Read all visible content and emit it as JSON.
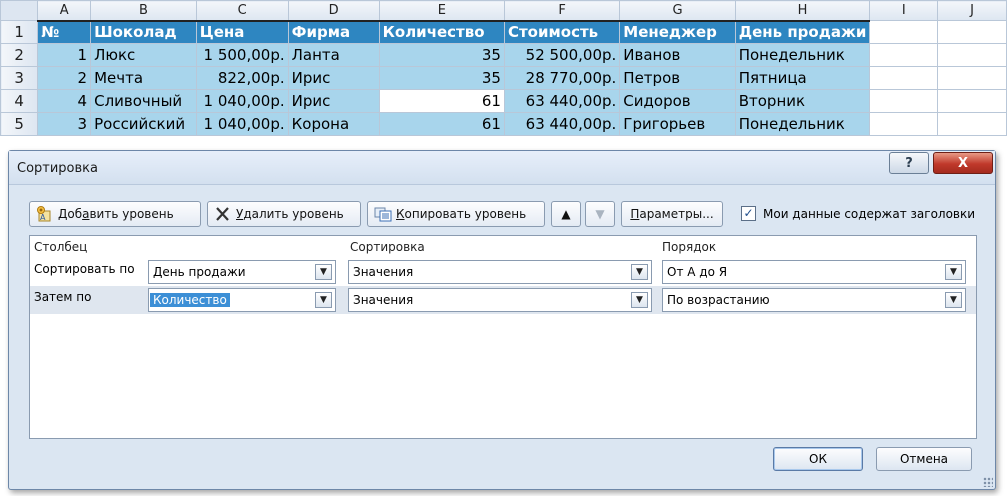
{
  "sheet": {
    "corner": "",
    "col_letters": [
      "A",
      "B",
      "C",
      "D",
      "E",
      "F",
      "G",
      "H",
      "I",
      "J"
    ],
    "rows": [
      {
        "n": "1",
        "cells": [
          "№",
          "Шоколад",
          "Цена",
          "Фирма",
          "Количество",
          "Стоимость",
          "Менеджер",
          "День продажи"
        ]
      },
      {
        "n": "2",
        "cells": [
          "1",
          "Люкс",
          "1 500,00р.",
          "Ланта",
          "35",
          "52 500,00р.",
          "Иванов",
          "Понедельник"
        ]
      },
      {
        "n": "3",
        "cells": [
          "2",
          "Мечта",
          "822,00р.",
          "Ирис",
          "35",
          "28 770,00р.",
          "Петров",
          "Пятница"
        ]
      },
      {
        "n": "4",
        "cells": [
          "4",
          "Сливочный",
          "1 040,00р.",
          "Ирис",
          "61",
          "63 440,00р.",
          "Сидоров",
          "Вторник"
        ]
      },
      {
        "n": "5",
        "cells": [
          "3",
          "Российский",
          "1 040,00р.",
          "Корона",
          "61",
          "63 440,00р.",
          "Григорьев",
          "Понедельник"
        ]
      }
    ]
  },
  "dialog": {
    "title": "Сортировка",
    "help_label": "?",
    "close_label": "X",
    "toolbar": {
      "add_level_pre": "Доб",
      "add_level_u": "а",
      "add_level_post": "вить уровень",
      "delete_level_u": "У",
      "delete_level_post": "далить уровень",
      "copy_level_u": "К",
      "copy_level_post": "опировать уровень",
      "up_label": "▲",
      "down_label": "▼",
      "params_u": "П",
      "params_post": "араметры...",
      "header_check_mark": "✓",
      "header_check_label": "Мои данные содержат заголовки",
      "header_checked": true
    },
    "grid": {
      "col_column": "Столбец",
      "col_sort": "Сортировка",
      "col_order": "Порядок",
      "levels": [
        {
          "label": "Сортировать по",
          "column": "День продажи",
          "sort_on": "Значения",
          "order": "От А до Я"
        },
        {
          "label": "Затем по",
          "column": "Количество",
          "sort_on": "Значения",
          "order": "По возрастанию"
        }
      ]
    },
    "ok_label": "ОК",
    "cancel_label": "Отмена"
  },
  "colors": {
    "header_fill": "#2e86c1",
    "data_fill": "#a8d5ec",
    "dialog_bg": "#dbe6f2",
    "close_red": "#c0392b",
    "selection_blue": "#3c8fd6"
  }
}
